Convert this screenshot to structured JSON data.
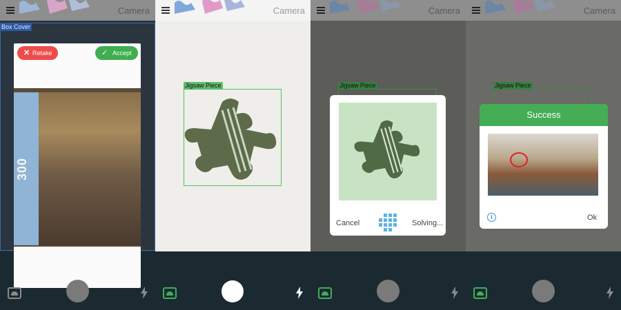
{
  "screens": [
    {
      "title": "Camera",
      "detection_label": "Box Cover",
      "retake_label": "Retake",
      "accept_label": "Accept",
      "box_text": "300"
    },
    {
      "title": "Camera",
      "detection_label": "Jigsaw Piece"
    },
    {
      "title": "Camera",
      "detection_label": "Jigsaw Piece",
      "cancel_label": "Cancel",
      "solving_label": "Solving..."
    },
    {
      "title": "Camera",
      "detection_label": "Jigsaw Piece",
      "success_title": "Success",
      "ok_label": "Ok"
    }
  ],
  "icons": {
    "menu": "hamburger-menu-icon",
    "gallery": "gallery-icon",
    "flash": "flash-icon",
    "shutter": "shutter-button",
    "info": "info-icon",
    "grid": "puzzle-grid-icon"
  },
  "colors": {
    "accept": "#3fae4f",
    "retake": "#ef4b4b",
    "detection": "#4fc35d",
    "success": "#44ad55",
    "info": "#3d8fd6",
    "grid": "#5ab2e6",
    "box_cover_frame": "#3c6aa8"
  }
}
